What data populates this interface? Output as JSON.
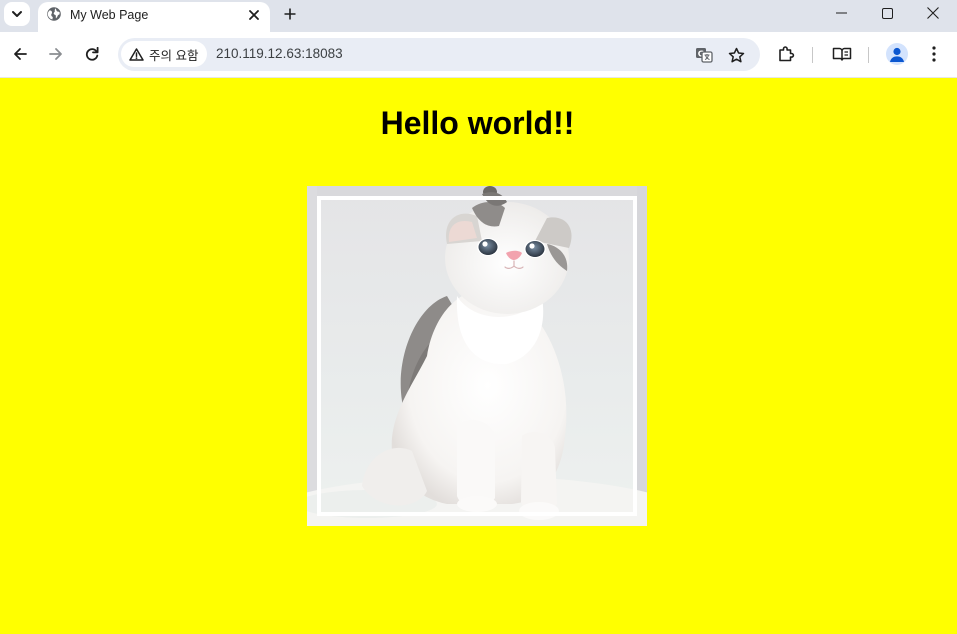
{
  "browser": {
    "tab_title": "My Web Page",
    "security_chip": "주의 요함",
    "url": "210.119.12.63:18083",
    "icons": [
      "tab-search-icon",
      "globe-icon",
      "close-icon",
      "plus-icon",
      "minimize-icon",
      "maximize-icon",
      "window-close-icon",
      "back-arrow-icon",
      "forward-arrow-icon",
      "reload-icon",
      "warning-icon",
      "translate-icon",
      "star-icon",
      "extensions-icon",
      "reading-mode-icon",
      "profile-icon",
      "menu-dots-icon"
    ]
  },
  "page": {
    "background": "#ffff00",
    "heading": "Hello world!!",
    "image": {
      "subject": "kitten photo"
    }
  }
}
